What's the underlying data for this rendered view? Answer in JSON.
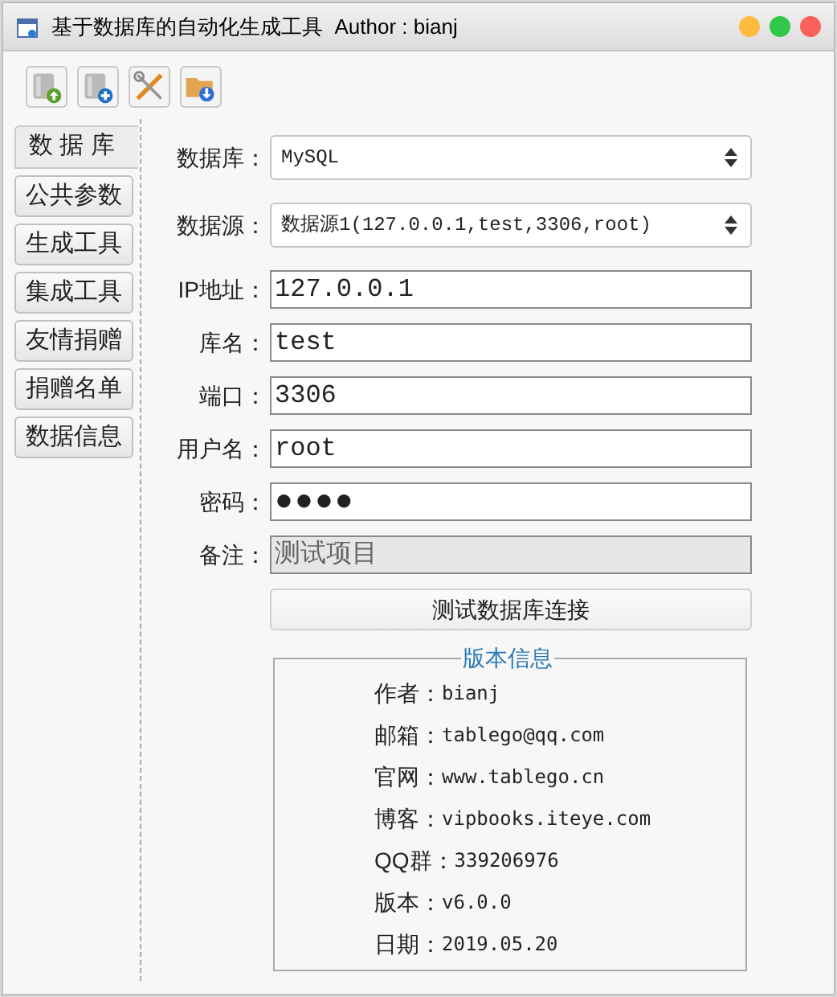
{
  "window": {
    "title": "基于数据库的自动化生成工具  Author : bianj"
  },
  "toolbar": [
    {
      "kind": "db-up"
    },
    {
      "kind": "db-add"
    },
    {
      "kind": "tools"
    },
    {
      "kind": "folder-down"
    }
  ],
  "sidebar": {
    "items": [
      {
        "label": "数 据 库",
        "selected": true
      },
      {
        "label": "公共参数",
        "selected": false
      },
      {
        "label": "生成工具",
        "selected": false
      },
      {
        "label": "集成工具",
        "selected": false
      },
      {
        "label": "友情捐赠",
        "selected": false
      },
      {
        "label": "捐赠名单",
        "selected": false
      },
      {
        "label": "数据信息",
        "selected": false
      }
    ]
  },
  "form": {
    "fields": [
      {
        "label": "数据库：",
        "kind": "select",
        "value": "MySQL",
        "disabled": false
      },
      {
        "label": "数据源：",
        "kind": "select",
        "value": "数据源1(127.0.0.1,test,3306,root)",
        "disabled": false
      },
      {
        "label": "IP地址：",
        "kind": "input",
        "value": "127.0.0.1",
        "disabled": false
      },
      {
        "label": "库名：",
        "kind": "input",
        "value": "test",
        "disabled": false
      },
      {
        "label": "端口：",
        "kind": "input",
        "value": "3306",
        "disabled": false
      },
      {
        "label": "用户名：",
        "kind": "input",
        "value": "root",
        "disabled": false
      },
      {
        "label": "密码：",
        "kind": "password",
        "value": "●●●●",
        "disabled": false
      },
      {
        "label": "备注：",
        "kind": "input",
        "value": "测试项目",
        "disabled": true
      }
    ],
    "test_button": "测试数据库连接"
  },
  "version_info": {
    "title": "版本信息",
    "rows": [
      {
        "label": "作者：",
        "value": "bianj"
      },
      {
        "label": "邮箱：",
        "value": "tablego@qq.com"
      },
      {
        "label": "官网：",
        "value": "www.tablego.cn"
      },
      {
        "label": "博客：",
        "value": "vipbooks.iteye.com"
      },
      {
        "label": "QQ群：",
        "value": "339206976"
      },
      {
        "label": "版本：",
        "value": "v6.0.0"
      },
      {
        "label": "日期：",
        "value": "2019.05.20"
      }
    ]
  }
}
